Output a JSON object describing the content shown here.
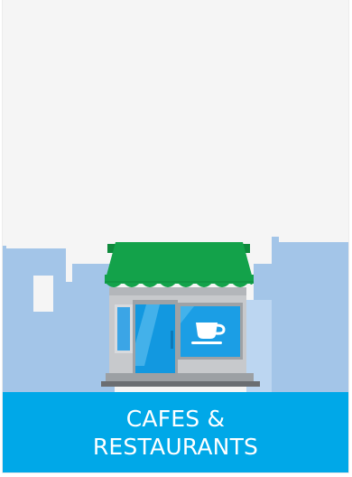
{
  "category_tile": {
    "title_lines": [
      "CAFES &",
      "RESTAURANTS"
    ],
    "icon": "storefront-with-coffee-cup-icon",
    "colors": {
      "background": "#f5f5f5",
      "skyline": "#a3c5e8",
      "awning": "#13a24a",
      "banner": "#00a8e8",
      "banner_text": "#ffffff"
    }
  }
}
